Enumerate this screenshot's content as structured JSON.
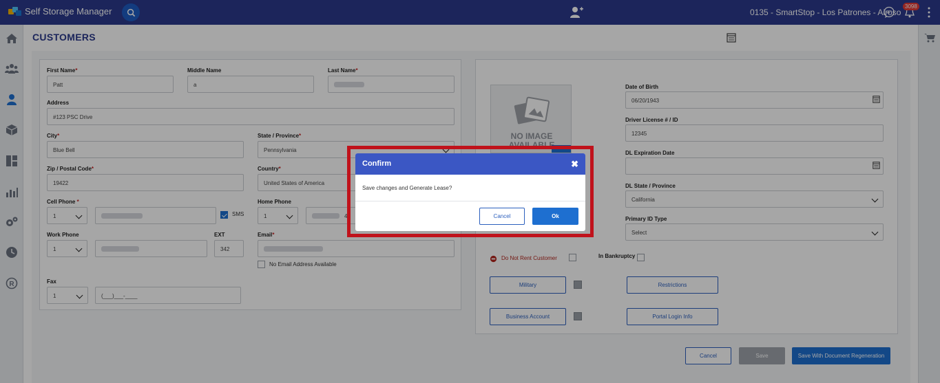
{
  "app": {
    "title": "Self Storage Manager",
    "store": "0135 - SmartStop - Los Patrones - Airoso",
    "notification_count": "3098"
  },
  "page": {
    "title": "CUSTOMERS"
  },
  "form": {
    "first_name": {
      "label": "First Name",
      "value": "Patt"
    },
    "middle_name": {
      "label": "Middle Name",
      "value": "a"
    },
    "last_name": {
      "label": "Last Name"
    },
    "address": {
      "label": "Address",
      "value": "#123 PSC Drive"
    },
    "city": {
      "label": "City",
      "value": "Blue Bell"
    },
    "state": {
      "label": "State / Province",
      "value": "Pennsylvania"
    },
    "zip": {
      "label": "Zip / Postal Code",
      "value": "19422"
    },
    "country": {
      "label": "Country",
      "value": "United States of America"
    },
    "cell_phone": {
      "label": "Cell Phone",
      "prefix": "1",
      "sms_label": "SMS"
    },
    "home_phone": {
      "label": "Home Phone",
      "prefix": "1",
      "tail": "4"
    },
    "work_phone": {
      "label": "Work Phone",
      "prefix": "1"
    },
    "ext": {
      "label": "EXT",
      "value": "342"
    },
    "email": {
      "label": "Email",
      "no_email_label": "No Email Address Available"
    },
    "fax": {
      "label": "Fax",
      "prefix": "1",
      "value": "(___)___-____"
    },
    "required_mark": "*"
  },
  "side": {
    "photo_text_line1": "NO IMAGE",
    "photo_text_line2": "AVAILABLE",
    "dob": {
      "label": "Date of Birth",
      "value": "06/20/1943"
    },
    "license": {
      "label": "Driver License # / ID",
      "value": "12345"
    },
    "dl_exp": {
      "label": "DL Expiration Date",
      "value": ""
    },
    "dl_state": {
      "label": "DL State / Province",
      "value": "California"
    },
    "id_type": {
      "label": "Primary ID Type",
      "value": "Select"
    },
    "do_not_rent": "Do Not Rent Customer",
    "bankruptcy": "In Bankruptcy",
    "military": "Military",
    "restrictions": "Restrictions",
    "business": "Business Account",
    "portal": "Portal Login Info"
  },
  "footer": {
    "cancel": "Cancel",
    "save": "Save",
    "save_regen": "Save With Document Regeneration"
  },
  "modal": {
    "title": "Confirm",
    "message": "Save changes and Generate Lease?",
    "cancel": "Cancel",
    "ok": "Ok",
    "close": "✖"
  },
  "colors": {
    "header": "#2b3a8c",
    "accent": "#1e6fd0",
    "modal_header": "#3b57c4",
    "highlight": "#c0121b"
  },
  "icons": [
    "home-icon",
    "users-icon",
    "user-icon",
    "box-icon",
    "dashboard-icon",
    "reports-icon",
    "settings-icon",
    "clock-icon",
    "registered-icon",
    "cart-icon",
    "search-icon",
    "add-user-icon",
    "chat-icon",
    "bell-icon",
    "calendar-icon",
    "chevron-down-icon",
    "close-icon"
  ]
}
